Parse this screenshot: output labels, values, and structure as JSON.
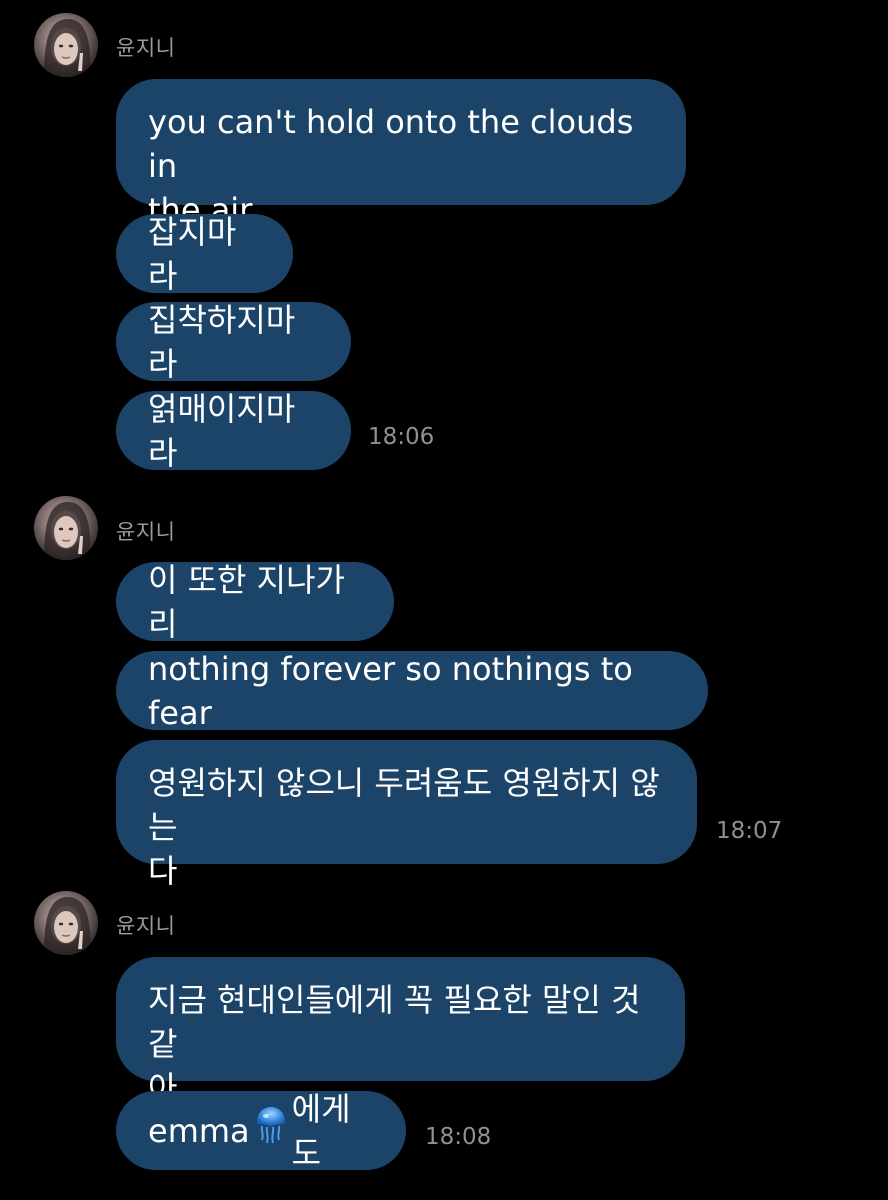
{
  "sender_name": "윤지니",
  "groups": [
    {
      "messages": [
        "you can't hold onto the clouds in\nthe air",
        "잡지마라",
        "집착하지마라",
        "얽매이지마라"
      ],
      "time": "18:06"
    },
    {
      "messages": [
        "이 또한 지나가리",
        "nothing forever so nothings to fear",
        "영원하지 않으니 두려움도 영원하지 않는\n다"
      ],
      "time": "18:07"
    },
    {
      "messages": [
        "지금 현대인들에게 꼭 필요한 말인 것 같\n아"
      ],
      "last_message_parts": [
        "emma",
        "에게도"
      ],
      "emoji_icon": "jellyfish-icon",
      "time": "18:08"
    }
  ],
  "colors": {
    "background": "#000000",
    "bubble": "#1c4468",
    "name_text": "#9a9aa0",
    "timestamp_text": "#8f8f95"
  }
}
